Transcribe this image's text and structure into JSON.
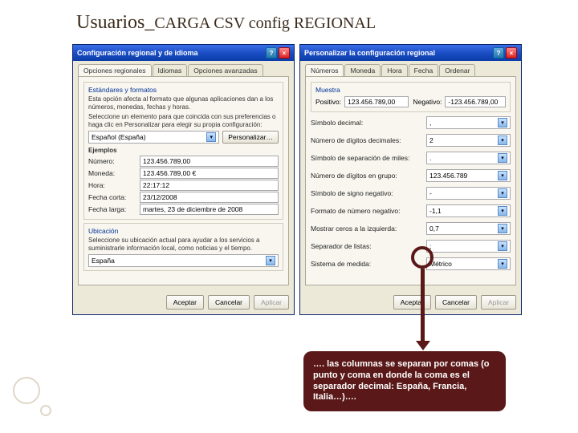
{
  "title": {
    "main": "Usuarios_",
    "sub": "CARGA CSV config REGIONAL"
  },
  "win1": {
    "title": "Configuración regional y de idioma",
    "tabs": [
      "Opciones regionales",
      "Idiomas",
      "Opciones avanzadas"
    ],
    "group1_title": "Estándares y formatos",
    "group1_note": "Esta opción afecta al formato que algunas aplicaciones dan a los números, monedas, fechas y horas.",
    "group1_note2": "Seleccione un elemento para que coincida con sus preferencias o haga clic en Personalizar para elegir su propia configuración:",
    "locale": "Español (España)",
    "btn_custom": "Personalizar…",
    "examples_title": "Ejemplos",
    "ex_num_label": "Número:",
    "ex_num": "123.456.789,00",
    "ex_cur_label": "Moneda:",
    "ex_cur": "123.456.789,00 €",
    "ex_time_label": "Hora:",
    "ex_time": "22:17:12",
    "ex_sdate_label": "Fecha corta:",
    "ex_sdate": "23/12/2008",
    "ex_ldate_label": "Fecha larga:",
    "ex_ldate": "martes, 23 de diciembre de 2008",
    "group2_title": "Ubicación",
    "group2_note": "Seleccione su ubicación actual para ayudar a los servicios a suministrarle información local, como noticias y el tiempo.",
    "country": "España"
  },
  "win2": {
    "title": "Personalizar la configuración regional",
    "tabs": [
      "Números",
      "Moneda",
      "Hora",
      "Fecha",
      "Ordenar"
    ],
    "sample_title": "Muestra",
    "pos_label": "Positivo:",
    "pos": "123.456.789,00",
    "neg_label": "Negativo:",
    "neg": "-123.456.789,00",
    "r1_label": "Símbolo decimal:",
    "r1_val": ",",
    "r2_label": "Número de dígitos decimales:",
    "r2_val": "2",
    "r3_label": "Símbolo de separación de miles:",
    "r3_val": ".",
    "r4_label": "Número de dígitos en grupo:",
    "r4_val": "123.456.789",
    "r5_label": "Símbolo de signo negativo:",
    "r5_val": "-",
    "r6_label": "Formato de número negativo:",
    "r6_val": "-1,1",
    "r7_label": "Mostrar ceros a la izquierda:",
    "r7_val": "0,7",
    "r8_label": "Separador de listas:",
    "r8_val": ";",
    "r9_label": "Sistema de medida:",
    "r9_val": "Métrico"
  },
  "buttons": {
    "ok": "Aceptar",
    "cancel": "Cancelar",
    "apply": "Aplicar"
  },
  "callout": "…. las columnas se separan por comas (o punto y coma en donde la coma es el separador decimal: España, Francia, Italia…)…."
}
